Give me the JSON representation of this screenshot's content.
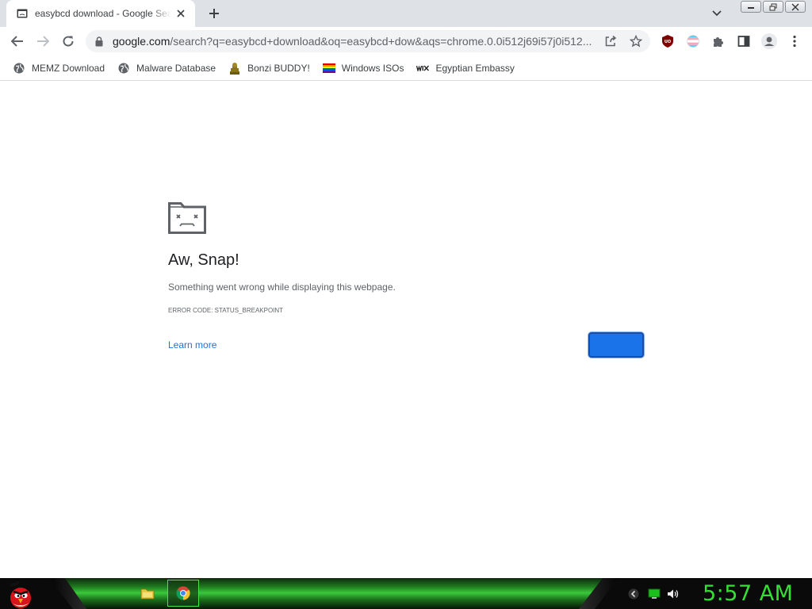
{
  "tab": {
    "title": "easybcd download - Google Search"
  },
  "omnibox": {
    "host": "google.com",
    "path": "/search?q=easybcd+download&oq=easybcd+dow&aqs=chrome.0.0i512j69i57j0i512..."
  },
  "bookmarks": [
    {
      "label": "MEMZ Download",
      "icon": "globe-icon"
    },
    {
      "label": "Malware Database",
      "icon": "globe-icon"
    },
    {
      "label": "Bonzi BUDDY!",
      "icon": "bonzi-icon"
    },
    {
      "label": "Windows ISOs",
      "icon": "rainbow-flag-icon"
    },
    {
      "label": "Egyptian Embassy",
      "icon": "wix-icon"
    }
  ],
  "crash_page": {
    "title": "Aw, Snap!",
    "message": "Something went wrong while displaying this webpage.",
    "error_code": "Error code: STATUS_BREAKPOINT",
    "learn_more": "Learn more",
    "reload_label": ""
  },
  "taskbar": {
    "clock": "5:57 AM"
  },
  "colors": {
    "accent": "#1a73e8",
    "clock": "#35e035",
    "taskbar_green": "#3ac83a"
  }
}
